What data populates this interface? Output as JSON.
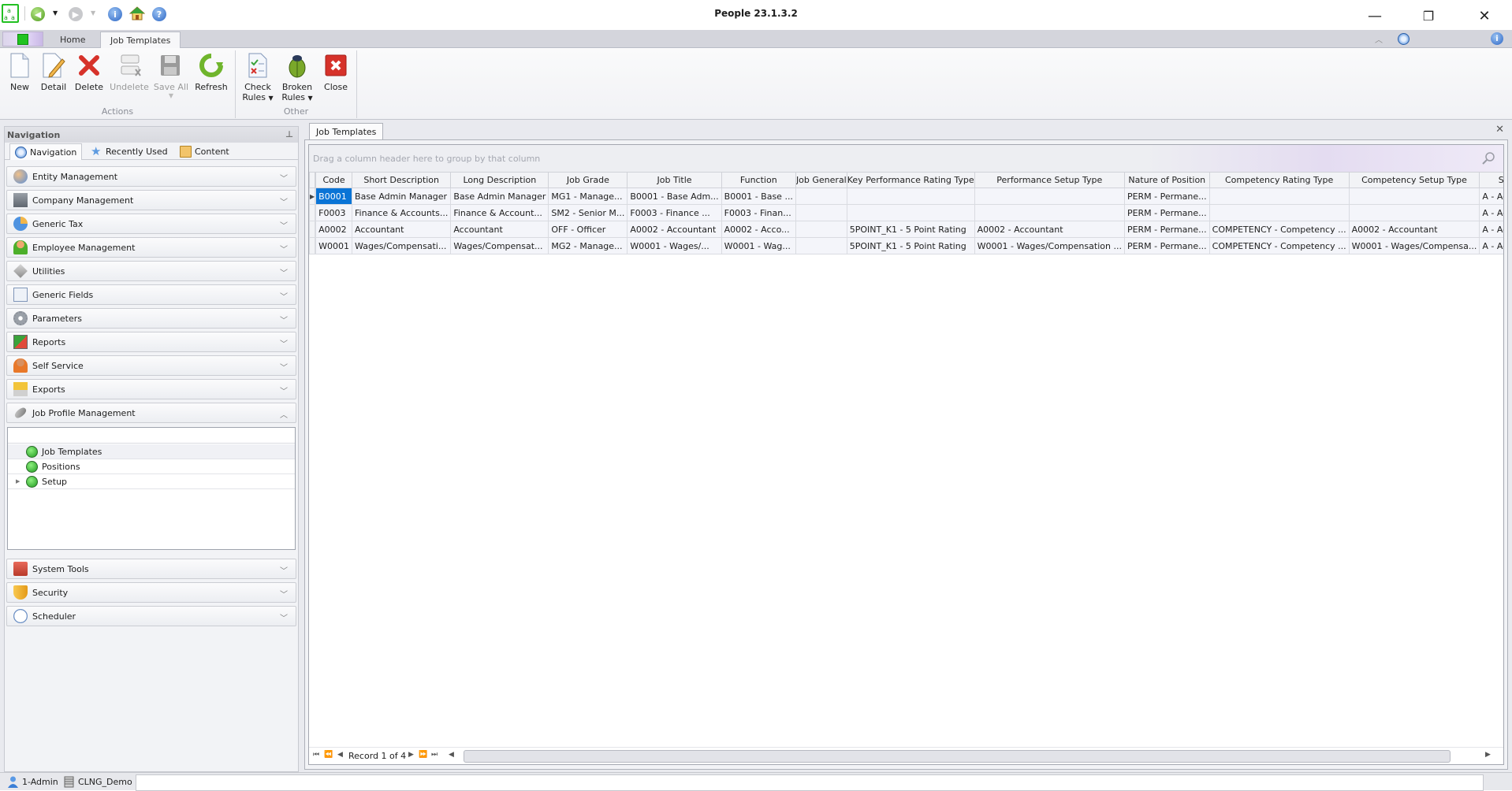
{
  "window": {
    "title": "People 23.1.3.2",
    "controls": {
      "minimize": "—",
      "restore": "❐",
      "close": "✕"
    }
  },
  "quick_access": {
    "icons": [
      "app-logo-icon",
      "back-icon",
      "dropdown-icon",
      "forward-icon",
      "dropdown-icon",
      "info-icon",
      "home-icon",
      "help-icon"
    ]
  },
  "ribbon": {
    "tabs": [
      {
        "label": "Home",
        "active": false
      },
      {
        "label": "Job Templates",
        "active": true
      }
    ],
    "theme": "Office 2010",
    "groups": [
      {
        "label": "Actions",
        "buttons": [
          {
            "label": "New",
            "enabled": true
          },
          {
            "label": "Detail",
            "enabled": true
          },
          {
            "label": "Delete",
            "enabled": true
          },
          {
            "label": "Undelete",
            "enabled": false
          },
          {
            "label": "Save All",
            "enabled": false
          },
          {
            "label": "Refresh",
            "enabled": true
          }
        ]
      },
      {
        "label": "Other",
        "buttons": [
          {
            "label_line1": "Check",
            "label_line2": "Rules",
            "enabled": true
          },
          {
            "label_line1": "Broken",
            "label_line2": "Rules",
            "enabled": true
          },
          {
            "label": "Close",
            "enabled": true
          }
        ]
      }
    ]
  },
  "navigation": {
    "title": "Navigation",
    "tabs": [
      {
        "label": "Navigation",
        "icon": "compass-icon",
        "active": true
      },
      {
        "label": "Recently Used",
        "icon": "star-icon",
        "active": false
      },
      {
        "label": "Content",
        "icon": "folder-icon",
        "active": false
      }
    ],
    "groups": [
      {
        "label": "Entity Management",
        "icon": "users-icon",
        "expanded": false
      },
      {
        "label": "Company Management",
        "icon": "bank-icon",
        "expanded": false
      },
      {
        "label": "Generic Tax",
        "icon": "pie-chart-icon",
        "expanded": false
      },
      {
        "label": "Employee Management",
        "icon": "employee-icon",
        "expanded": false
      },
      {
        "label": "Utilities",
        "icon": "tools-icon",
        "expanded": false
      },
      {
        "label": "Generic Fields",
        "icon": "document-wrench-icon",
        "expanded": false
      },
      {
        "label": "Parameters",
        "icon": "gear-icon",
        "expanded": false
      },
      {
        "label": "Reports",
        "icon": "report-icon",
        "expanded": false
      },
      {
        "label": "Self Service",
        "icon": "person-icon",
        "expanded": false
      },
      {
        "label": "Exports",
        "icon": "export-icon",
        "expanded": false
      },
      {
        "label": "Job Profile Management",
        "icon": "chain-link-icon",
        "expanded": true
      },
      {
        "label": "System Tools",
        "icon": "toolbox-icon",
        "expanded": false
      },
      {
        "label": "Security",
        "icon": "shield-icon",
        "expanded": false
      },
      {
        "label": "Scheduler",
        "icon": "clock-icon",
        "expanded": false
      }
    ],
    "tree": [
      {
        "label": "Job Templates",
        "selected": true,
        "expandable": false
      },
      {
        "label": "Positions",
        "selected": false,
        "expandable": false
      },
      {
        "label": "Setup",
        "selected": false,
        "expandable": true
      }
    ]
  },
  "document": {
    "tab_label": "Job Templates",
    "group_panel_hint": "Drag a column header here to group by that column",
    "columns": [
      "Code",
      "Short Description",
      "Long Description",
      "Job Grade",
      "Job Title",
      "Function",
      "Job General",
      "Key Performance Rating Type",
      "Performance Setup Type",
      "Nature of Position",
      "Competency Rating Type",
      "Competency Setup Type",
      "Status"
    ],
    "rows": [
      [
        "B0001",
        "Base Admin Manager",
        "Base Admin Manager",
        "MG1 - Manage...",
        "B0001 - Base Adm...",
        "B0001 - Base ...",
        "",
        "",
        "",
        "PERM - Permane...",
        "",
        "",
        "A - Active"
      ],
      [
        "F0003",
        "Finance & Accounts...",
        "Finance & Account...",
        "SM2 - Senior M...",
        "F0003 - Finance ...",
        "F0003 - Finan...",
        "",
        "",
        "",
        "PERM - Permane...",
        "",
        "",
        "A - Active"
      ],
      [
        "A0002",
        "Accountant",
        "Accountant",
        "OFF - Officer",
        "A0002 - Accountant",
        "A0002 - Acco...",
        "",
        "5POINT_K1 - 5 Point Rating",
        "A0002 - Accountant",
        "PERM - Permane...",
        "COMPETENCY - Competency ...",
        "A0002 - Accountant",
        "A - Active"
      ],
      [
        "W0001",
        "Wages/Compensati...",
        "Wages/Compensat...",
        "MG2 - Manage...",
        "W0001 - Wages/...",
        "W0001 - Wag...",
        "",
        "5POINT_K1 - 5 Point Rating",
        "W0001 - Wages/Compensation ...",
        "PERM - Permane...",
        "COMPETENCY - Competency ...",
        "W0001 - Wages/Compensa...",
        "A - Active"
      ]
    ],
    "selected_row": 0,
    "pager_text": "Record 1 of 4"
  },
  "status_bar": {
    "user": "1-Admin",
    "database": "CLNG_Demo"
  }
}
